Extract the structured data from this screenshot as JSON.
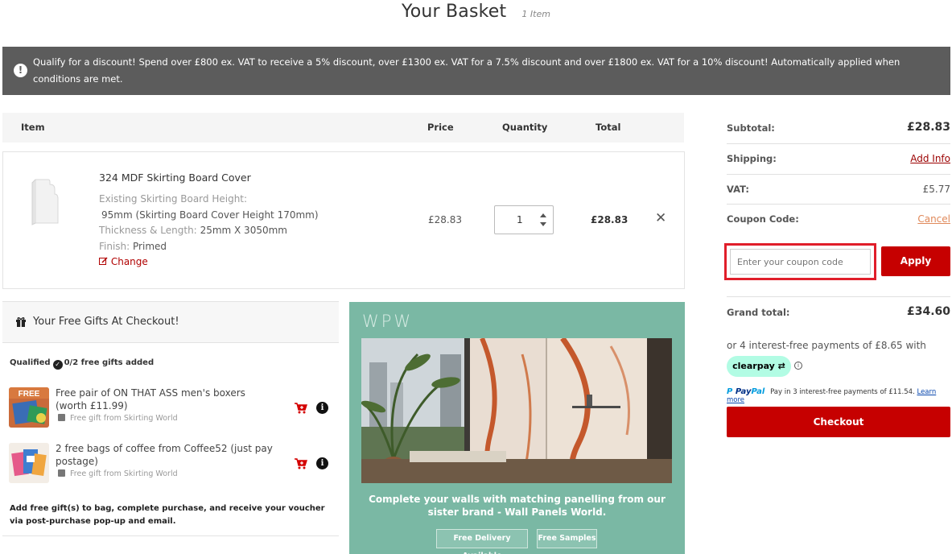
{
  "header": {
    "title": "Your Basket",
    "item_count": "1 Item"
  },
  "notice": {
    "icon": "exclamation-icon",
    "text": "Qualify for a discount! Spend over £800 ex. VAT to receive a 5% discount, over £1300 ex. VAT for a 7.5% discount and over £1800 ex. VAT for a 10% discount! Automatically applied when conditions are met."
  },
  "table": {
    "columns": [
      "Item",
      "Price",
      "Quantity",
      "Total"
    ]
  },
  "item": {
    "name": "324 MDF Skirting Board Cover",
    "attr1_label": "Existing Skirting Board Height:",
    "attr1_value": "95mm (Skirting Board Cover Height 170mm)",
    "attr2_label": "Thickness & Length:",
    "attr2_value": "25mm X 3050mm",
    "attr3_label": "Finish:",
    "attr3_value": "Primed",
    "change_label": "Change",
    "price": "£28.83",
    "quantity": "1",
    "total": "£28.83"
  },
  "gifts": {
    "title": "Your Free Gifts At Checkout!",
    "qualified_label": "Qualified",
    "progress": "0/2 free gifts added",
    "items": [
      {
        "title": "Free pair of ON THAT ASS men's boxers (worth £11.99)",
        "source": "Free gift from Skirting World",
        "badge": "FREE"
      },
      {
        "title": "2 free bags of coffee from Coffee52 (just pay postage)",
        "source": "Free gift from Skirting World"
      }
    ],
    "note": "Add free gift(s) to bag, complete purchase, and receive your voucher via post-purchase pop-up and email."
  },
  "promo": {
    "logo": "WPW",
    "text": "Complete your walls with matching panelling from our sister brand - Wall Panels World.",
    "buttons": [
      "Free Delivery Available",
      "Free Samples"
    ]
  },
  "summary": {
    "subtotal_label": "Subtotal:",
    "subtotal": "£28.83",
    "shipping_label": "Shipping:",
    "shipping_link": "Add Info",
    "vat_label": "VAT:",
    "vat": "£5.77",
    "coupon_label": "Coupon Code:",
    "cancel_link": "Cancel",
    "coupon_placeholder": "Enter your coupon code",
    "apply_label": "Apply",
    "grand_total_label": "Grand total:",
    "grand_total": "£34.60",
    "installments_text": "or 4 interest-free payments of £8.65 with",
    "clearpay_label": "clearpay",
    "paypal_text": "Pay in 3 interest-free payments of £11.54.",
    "paypal_learn_more": "Learn more",
    "checkout_label": "Checkout"
  },
  "colors": {
    "accent_red": "#c60000",
    "notice_bg": "#5c5c5c",
    "promo_bg": "#7ab8a4",
    "highlight_border": "#e01e2a",
    "clearpay_bg": "#b2fce4"
  }
}
